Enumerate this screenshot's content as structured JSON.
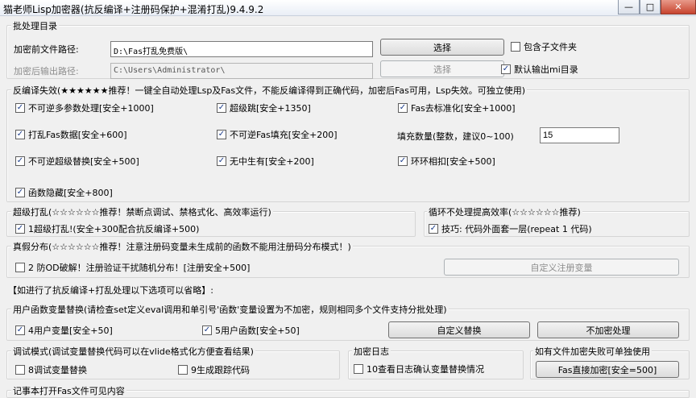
{
  "window": {
    "title": "猫老师Lisp加密器(抗反编译+注册码保护+混淆打乱)9.4.9.2",
    "minimize_glyph": "—",
    "maximize_glyph": "□",
    "close_glyph": "✕"
  },
  "batch": {
    "title": "批处理目录",
    "src_label": "加密前文件路径:",
    "src_value": "D:\\Fas打乱免费版\\",
    "select_btn": "选择",
    "include_sub": "包含子文件夹",
    "include_sub_checked": false,
    "out_label": "加密后输出路径:",
    "out_value": "C:\\Users\\Administrator\\",
    "select_btn2": "选择",
    "default_out": "默认输出mi目录",
    "default_out_checked": true
  },
  "decompile": {
    "title": "反编译失效(★★★★★★推荐！一键全自动处理Lsp及Fas文件，不能反编译得到正确代码，加密后Fas可用，Lsp失效。可独立使用)",
    "opt1": "不可逆多参数处理[安全+1000]",
    "opt2": "超级跳[安全+1350]",
    "opt3": "Fas去标准化[安全+1000]",
    "opt4": "打乱Fas数据[安全+600]",
    "opt5": "不可逆Fas填充[安全+200]",
    "fill_label": "填充数量(整数，建议0~100)",
    "fill_value": "15",
    "opt6": "不可逆超级替换[安全+500]",
    "opt7": "无中生有[安全+200]",
    "opt8": "环环相扣[安全+500]",
    "opt9": "函数隐藏[安全+800]"
  },
  "super": {
    "title": "超级打乱(☆☆☆☆☆☆推荐！禁断点调试、禁格式化、高效率运行)",
    "opt": "1超级打乱!(安全+300配合抗反编译+500)"
  },
  "loop": {
    "title": "循环不处理提高效率(☆☆☆☆☆☆推荐)",
    "opt": "技巧: 代码外面套一层(repeat 1 代码)"
  },
  "fake": {
    "title": "真假分布(☆☆☆☆☆☆推荐！注意注册码变量未生成前的函数不能用注册码分布模式！)",
    "opt": "2 防OD破解！注册验证干扰随机分布！[注册安全+500]",
    "custom_btn": "自定义注册变量"
  },
  "note": "【如进行了抗反编译+打乱处理以下选项可以省略】:",
  "replace": {
    "title": "用户函数变量替换(请检查set定义eval调用和单引号'函数'变量设置为不加密，规则相同多个文件支持分批处理)",
    "opt4": "4用户变量[安全+50]",
    "opt5": "5用户函数[安全+50]",
    "custom_btn": "自定义替换",
    "noenc_btn": "不加密处理"
  },
  "debug": {
    "title": "调试模式(调试变量替换代码可以在vlide格式化方便查看结果)",
    "opt8": "8调试变量替换",
    "opt9": "9生成跟踪代码"
  },
  "log": {
    "title": "加密日志",
    "opt": "10查看日志确认变量替换情况"
  },
  "fasdirect": {
    "title": "如有文件加密失败可单独使用",
    "btn": "Fas直接加密[安全=500]"
  },
  "bottom": {
    "title": "记事本打开Fas文件可见内容"
  },
  "checks": {
    "d1": true,
    "d2": true,
    "d3": true,
    "d4": true,
    "d5": true,
    "d6": true,
    "d7": true,
    "d8": true,
    "d9": true,
    "s1": true,
    "l1": true,
    "f2": false,
    "r4": true,
    "r5": true,
    "g8": false,
    "g9": false,
    "g10": false
  },
  "colors": {
    "check_mark": "#1a3b8a",
    "window_bg": "#f0f0f0"
  }
}
